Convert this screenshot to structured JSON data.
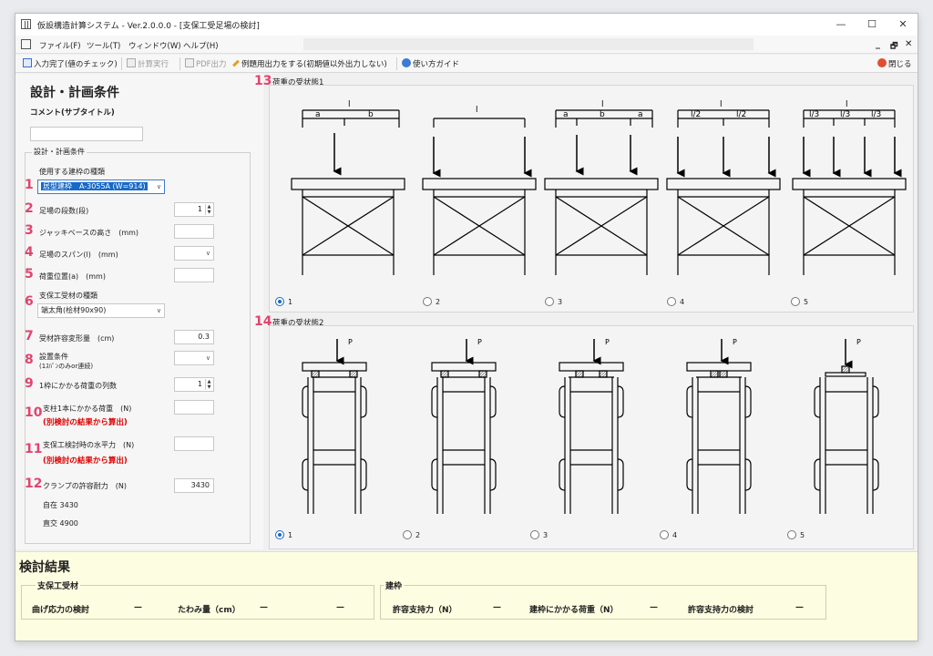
{
  "window": {
    "title": "仮設構造計算システム - Ver.2.0.0.0 - [支保工受足場の検討]",
    "controls": [
      "—",
      "☐",
      "✕"
    ],
    "mdi_controls": [
      "_",
      "🗗",
      "✕"
    ]
  },
  "menu": [
    "ファイル(F)",
    "ツール(T)",
    "ウィンドウ(W)",
    "ヘルプ(H)"
  ],
  "toolbar": {
    "items": [
      {
        "label": "入力完了(値のチェック)",
        "icon": "edit-document-icon",
        "enabled": true
      },
      {
        "label": "計算実行",
        "icon": "calculator-icon",
        "enabled": false
      },
      {
        "label": "PDF出力",
        "icon": "pdf-icon",
        "enabled": false
      },
      {
        "label": "例題用出力をする(初期値以外出力しない)",
        "icon": "pencil-icon",
        "enabled": true
      },
      {
        "label": "使い方ガイド",
        "icon": "help-icon",
        "enabled": true
      }
    ],
    "close_label": "閉じる"
  },
  "left": {
    "title": "設計・計画条件",
    "comment_label": "コメント(サブタイトル)",
    "comment_value": "",
    "group_title": "設計・計画条件",
    "rows": [
      {
        "num": "1",
        "label": "使用する建枠の種類",
        "value": "居型建枠　A-3055A (W=914)"
      },
      {
        "num": "2",
        "label": "足場の段数(段)",
        "value": "1"
      },
      {
        "num": "3",
        "label": "ジャッキベースの高さ　(mm)",
        "value": ""
      },
      {
        "num": "4",
        "label": "足場のスパン(l)　(mm)",
        "value": ""
      },
      {
        "num": "5",
        "label": "荷重位置(a)　(mm)",
        "value": ""
      },
      {
        "num": "6",
        "label": "支保工受材の種類",
        "value": "端太角(桧材90x90)"
      },
      {
        "num": "7",
        "label": "受材許容変形量　(cm)",
        "value": "0.3"
      },
      {
        "num": "8",
        "label": "設置条件",
        "label2": "(1ｽﾊﾟﾝのみor連続)",
        "value": ""
      },
      {
        "num": "9",
        "label": "1枠にかかる荷重の列数",
        "value": "1"
      },
      {
        "num": "10",
        "label": "支柱1本にかかる荷重　(N)",
        "note": "(別検討の結果から算出)",
        "value": ""
      },
      {
        "num": "11",
        "label": "支保工検討時の水平力　(N)",
        "note": "(別検討の結果から算出)",
        "value": ""
      },
      {
        "num": "12",
        "label": "クランプの許容耐力　(N)",
        "value": "3430"
      }
    ],
    "clamp_notes": [
      "自在 3430",
      "直交 4900"
    ]
  },
  "sec13": {
    "num": "13",
    "title": "荷重の受状態1",
    "options": [
      "1",
      "2",
      "3",
      "4",
      "5"
    ],
    "selected": "1",
    "diagram_labels": {
      "l": "l",
      "d1": [
        "a",
        "b"
      ],
      "d3": [
        "a",
        "b",
        "a"
      ],
      "d4": [
        "l/2",
        "l/2"
      ],
      "d5": [
        "l/3",
        "l/3",
        "l/3"
      ]
    }
  },
  "sec14": {
    "num": "14",
    "title": "荷重の受状態2",
    "options": [
      "1",
      "2",
      "3",
      "4",
      "5"
    ],
    "selected": "1",
    "load_label": "P"
  },
  "results": {
    "title": "検討結果",
    "group1": {
      "title": "支保工受材",
      "bending_label": "曲げ応力の検討",
      "bending_value": "—",
      "deflection_label": "たわみ量（cm）",
      "deflection_value": "—",
      "extra_value": "—"
    },
    "group2": {
      "title": "建枠",
      "allow_label": "許容支持力（N）",
      "allow_value": "—",
      "load_label": "建枠にかかる荷重（N）",
      "load_value": "—",
      "check_label": "許容支持力の検討",
      "check_value": "—"
    }
  }
}
